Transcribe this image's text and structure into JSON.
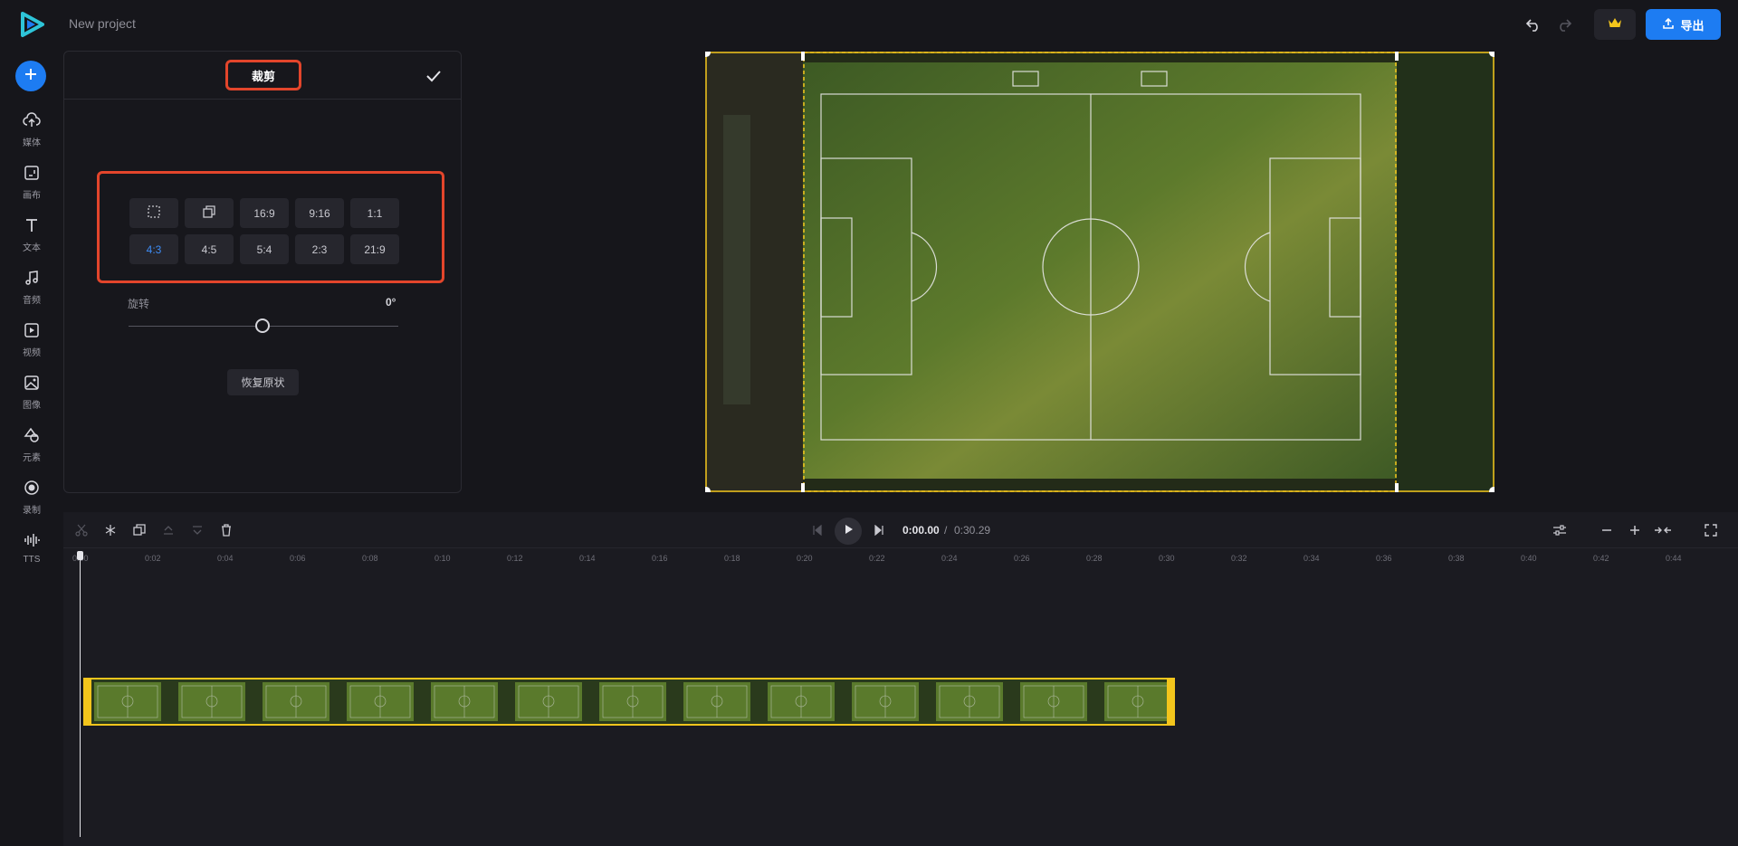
{
  "app": {
    "project_title": "New project"
  },
  "header": {
    "export_label": "导出",
    "icons": [
      "undo-icon",
      "redo-icon",
      "crown-icon",
      "upload-icon"
    ]
  },
  "sidebar": {
    "items": [
      {
        "label": "媒体",
        "icon": "upload-cloud-icon"
      },
      {
        "label": "画布",
        "icon": "canvas-icon"
      },
      {
        "label": "文本",
        "icon": "text-icon"
      },
      {
        "label": "音频",
        "icon": "music-icon"
      },
      {
        "label": "视频",
        "icon": "video-icon"
      },
      {
        "label": "图像",
        "icon": "image-icon"
      },
      {
        "label": "元素",
        "icon": "shapes-icon"
      },
      {
        "label": "录制",
        "icon": "record-icon"
      },
      {
        "label": "TTS",
        "icon": "tts-icon"
      }
    ]
  },
  "crop_panel": {
    "title": "裁剪",
    "ratios_row1": [
      "16:9",
      "9:16",
      "1:1"
    ],
    "ratios_row2": [
      "4:3",
      "4:5",
      "5:4",
      "2:3",
      "21:9"
    ],
    "active_ratio": "4:3",
    "rotation_label": "旋转",
    "rotation_value": "0°",
    "rotation_level": 0.5,
    "reset_label": "恢复原状"
  },
  "timeline": {
    "current_time": "0:00.00",
    "separator": "/",
    "total_time": "0:30.29",
    "ruler": [
      "0:00",
      "0:02",
      "0:04",
      "0:06",
      "0:08",
      "0:10",
      "0:12",
      "0:14",
      "0:16",
      "0:18",
      "0:20",
      "0:22",
      "0:24",
      "0:26",
      "0:28",
      "0:30",
      "0:32",
      "0:34",
      "0:36",
      "0:38",
      "0:40",
      "0:42",
      "0:44"
    ]
  },
  "colors": {
    "accent": "#1d7cf2",
    "highlight": "#e3452b",
    "clip": "#f3c51c"
  }
}
